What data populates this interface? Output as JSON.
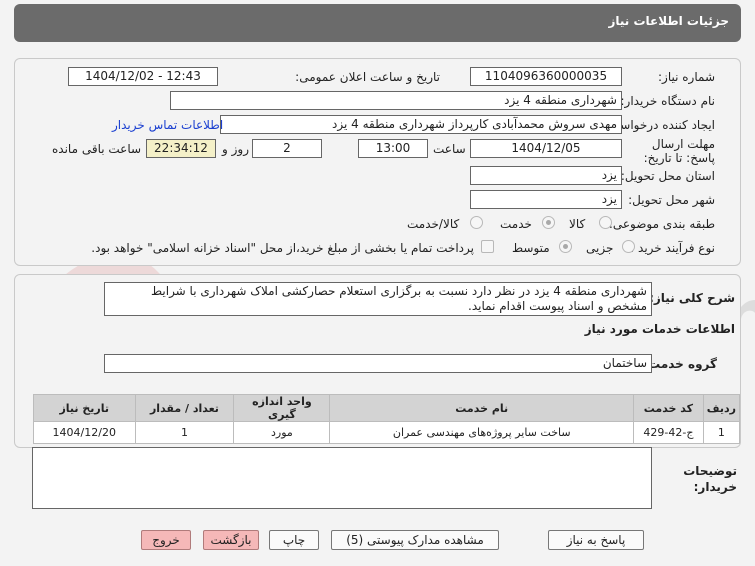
{
  "header": {
    "title": "جزئیات اطلاعات نیاز"
  },
  "form": {
    "need_number_label": "شماره نیاز:",
    "need_number": "1104096360000035",
    "announce_label": "تاریخ و ساعت اعلان عمومی:",
    "announce_value": "1404/12/02 - 12:43",
    "buyer_org_label": "نام دستگاه خریدار:",
    "buyer_org": "شهرداری منطقه 4 یزد",
    "creator_label": "ایجاد کننده درخواست:",
    "creator": "مهدی سروش محمدآبادی کارپرداز شهرداری منطقه 4 یزد",
    "contact_link": "اطلاعات تماس خریدار",
    "deadline_label": "مهلت ارسال پاسخ: تا تاریخ:",
    "deadline_date": "1404/12/05",
    "time_label": "ساعت",
    "deadline_time": "13:00",
    "days_value": "2",
    "days_label": "روز و",
    "remaining_time": "22:34:12",
    "remaining_label": "ساعت باقی مانده",
    "province_label": "استان محل تحویل:",
    "province": "یزد",
    "city_label": "شهر محل تحویل:",
    "city": "یزد",
    "category_label": "طبقه بندی موضوعی:",
    "category_options": [
      "کالا",
      "خدمت",
      "کالا/خدمت"
    ],
    "category_selected": "خدمت",
    "process_label": "نوع فرآیند خرید :",
    "process_options": [
      "جزیی",
      "متوسط"
    ],
    "process_selected": "متوسط",
    "payment_note": "پرداخت تمام یا بخشی از مبلغ خرید،از محل \"اسناد خزانه اسلامی\" خواهد بود."
  },
  "description": {
    "label": "شرح کلی نیاز:",
    "text": "شهرداری منطقه 4 یزد در نظر دارد نسبت به برگزاری استعلام حصارکشی املاک شهرداری با شرایط مشخص و اسناد پیوست اقدام نماید."
  },
  "services": {
    "section_title": "اطلاعات خدمات مورد نیاز",
    "group_label": "گروه خدمت:",
    "group_value": "ساختمان",
    "columns": [
      "ردیف",
      "کد خدمت",
      "نام خدمت",
      "واحد اندازه گیری",
      "تعداد / مقدار",
      "تاریخ نیاز"
    ],
    "rows": [
      [
        "1",
        "ج-42-429",
        "ساخت سایر پروژه‌های مهندسی عمران",
        "مورد",
        "1",
        "1404/12/20"
      ]
    ]
  },
  "buyer_notes": {
    "label": "توضیحات خریدار:",
    "text": ""
  },
  "buttons": {
    "reply": "پاسخ به نیاز",
    "attachments": "مشاهده مدارک پیوستی (5)",
    "print": "چاپ",
    "back": "بازگشت",
    "exit": "خروج"
  },
  "watermark": {
    "text": "AriaTender.net"
  },
  "colors": {
    "header_bg": "#6b6b6b",
    "link": "#1a3fd0",
    "pink_button": "#f5b8b8",
    "time_box": "#f4f0c8"
  }
}
